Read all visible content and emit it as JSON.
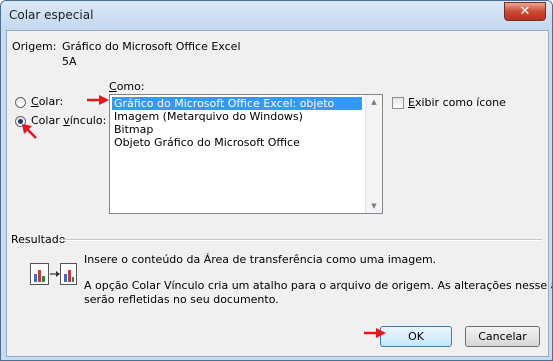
{
  "window": {
    "title": "Colar especial",
    "close_glyph": "✕"
  },
  "origin": {
    "label": "Origem:",
    "value_line1": "Gráfico do Microsoft Office Excel",
    "value_line2": "5A"
  },
  "como_label": "Como:",
  "paste_options": {
    "paste": {
      "label": "Colar:",
      "selected": false
    },
    "paste_link": {
      "label": "Colar vínculo:",
      "selected": true
    }
  },
  "list": {
    "items": [
      {
        "label": "Gráfico do Microsoft Office Excel: objeto",
        "selected": true
      },
      {
        "label": "Imagem (Metarquivo do Windows)",
        "selected": false
      },
      {
        "label": "Bitmap",
        "selected": false
      },
      {
        "label": "Objeto Gráfico do Microsoft Office",
        "selected": false
      }
    ]
  },
  "show_as_icon": {
    "label": "Exibir como ícone",
    "checked": false
  },
  "result": {
    "heading": "Resultado",
    "line1": "Insere o conteúdo da Área de transferência como uma imagem.",
    "line2": "A opção Colar Vínculo cria um atalho para o arquivo de origem. As alterações nesse arquivo",
    "line3": "serão refletidas no seu documento."
  },
  "buttons": {
    "ok": "OK",
    "cancel": "Cancelar"
  },
  "annotation_color": "#e8141c"
}
